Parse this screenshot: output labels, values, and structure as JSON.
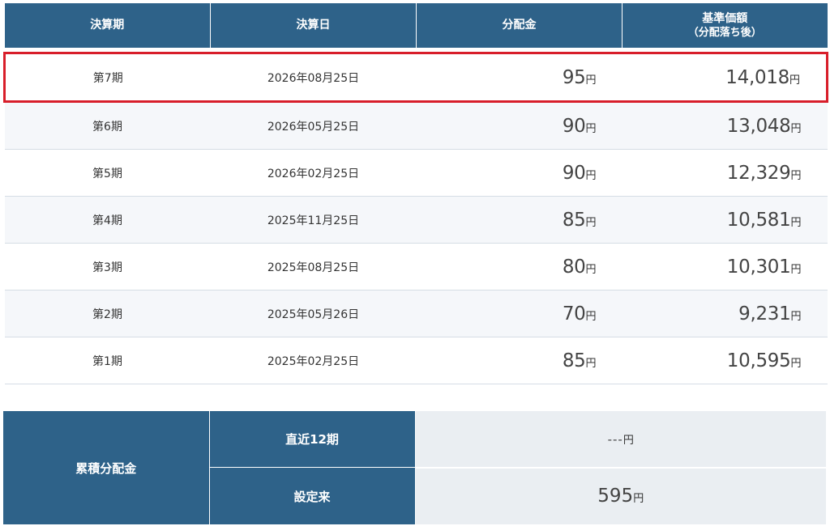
{
  "table": {
    "headers": {
      "period": "決算期",
      "date": "決算日",
      "distribution": "分配金",
      "nav": "基準価額",
      "nav_sub": "（分配落ち後）"
    },
    "unit": "円",
    "rows": [
      {
        "period": "第7期",
        "date": "2026年08月25日",
        "distribution": "95",
        "nav": "14,018"
      },
      {
        "period": "第6期",
        "date": "2026年05月25日",
        "distribution": "90",
        "nav": "13,048"
      },
      {
        "period": "第5期",
        "date": "2026年02月25日",
        "distribution": "90",
        "nav": "12,329"
      },
      {
        "period": "第4期",
        "date": "2025年11月25日",
        "distribution": "85",
        "nav": "10,581"
      },
      {
        "period": "第3期",
        "date": "2025年08月25日",
        "distribution": "80",
        "nav": "10,301"
      },
      {
        "period": "第2期",
        "date": "2025年05月26日",
        "distribution": "70",
        "nav": "9,231"
      },
      {
        "period": "第1期",
        "date": "2025年02月25日",
        "distribution": "85",
        "nav": "10,595"
      }
    ],
    "highlight_color": "#d81e2a",
    "header_color": "#2e6289"
  },
  "cumulative": {
    "label": "累積分配金",
    "recent_label": "直近12期",
    "recent_value": "---",
    "since_label": "設定来",
    "since_value": "595",
    "unit": "円"
  }
}
